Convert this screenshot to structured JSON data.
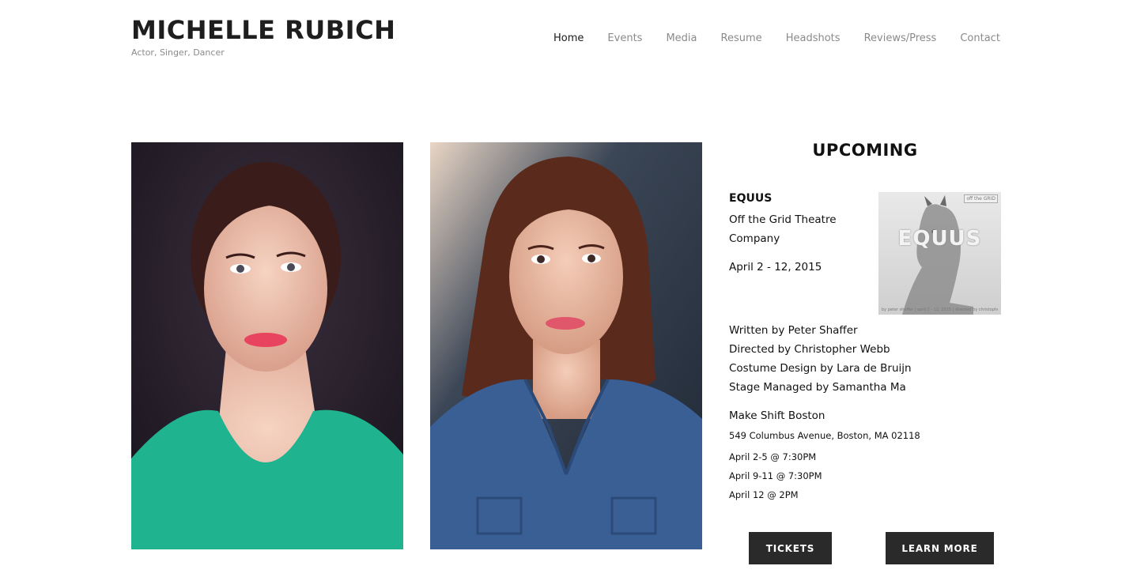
{
  "header": {
    "title": "MICHELLE RUBICH",
    "tagline": "Actor, Singer, Dancer"
  },
  "nav": {
    "items": [
      {
        "label": "Home",
        "active": true
      },
      {
        "label": "Events",
        "active": false
      },
      {
        "label": "Media",
        "active": false
      },
      {
        "label": "Resume",
        "active": false
      },
      {
        "label": "Headshots",
        "active": false
      },
      {
        "label": "Reviews/Press",
        "active": false
      },
      {
        "label": "Contact",
        "active": false
      }
    ]
  },
  "upcoming": {
    "heading": "UPCOMING",
    "event": {
      "title": "EQUUS",
      "company_line1": "Off the Grid Theatre",
      "company_line2": "Company",
      "dates": "April 2 - 12, 2015",
      "poster": {
        "word": "EQUUS",
        "logo": "off the GRID",
        "caption": "by peter shaffer | april 2 - 12, 2015 | directed by christopher webb"
      },
      "credits": [
        "Written by Peter Shaffer",
        "Directed by Christopher Webb",
        "Costume Design by Lara de Bruijn",
        "Stage Managed by Samantha Ma"
      ],
      "venue": "Make Shift Boston",
      "address": "549 Columbus Avenue, Boston, MA 02118",
      "showtimes": [
        "April 2-5 @ 7:30PM",
        "April 9-11 @ 7:30PM",
        "April 12 @ 2PM"
      ]
    },
    "buttons": {
      "tickets": "TICKETS",
      "learn_more": "LEARN MORE"
    }
  },
  "colors": {
    "accent_dark": "#2a2a2a",
    "nav_inactive": "#8a8a8a",
    "shirt_teal": "#1fb38f",
    "shirt_denim": "#3a5f94"
  }
}
